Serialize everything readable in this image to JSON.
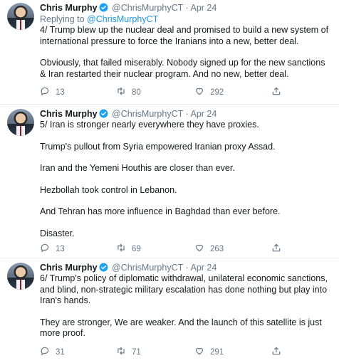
{
  "tweets": [
    {
      "author": "Chris Murphy",
      "handle": "@ChrisMurphyCT",
      "date": "Apr 24",
      "replying_prefix": "Replying to",
      "replying_to": "@ChrisMurphyCT",
      "paragraphs": [
        "4/ Trump blew up the nuclear deal and promised to build a new system of international pressure to force the Iranians into a new, better deal.",
        "Obviously, that failed miserably. Nobody signed up for the new sanctions & Iran restarted their nuclear program. And no new, better deal."
      ],
      "replies": "13",
      "retweets": "80",
      "likes": "292"
    },
    {
      "author": "Chris Murphy",
      "handle": "@ChrisMurphyCT",
      "date": "Apr 24",
      "paragraphs": [
        "5/ Iran is stronger nearly everywhere they have proxies.",
        "Trump's pullout from Syria empowered Iranian proxy Assad.",
        "Iran and the Yemeni Houthis are closer than ever.",
        "Hezbollah took control in Lebanon.",
        "And Tehran has more influence in Baghdad than ever before.",
        "Disaster."
      ],
      "replies": "13",
      "retweets": "69",
      "likes": "263"
    },
    {
      "author": "Chris Murphy",
      "handle": "@ChrisMurphyCT",
      "date": "Apr 24",
      "paragraphs": [
        "6/ Trump's policy of diplomatic withdrawal, unilateral economic sanctions, and blind, non-strategic military escalation has done nothing but play into Iran's hands.",
        "They are stronger, We are weaker. And the launch of this satellite is just more proof."
      ],
      "replies": "31",
      "retweets": "71",
      "likes": "291"
    }
  ],
  "separator": "·",
  "icons": {
    "avatar": "profile-photo",
    "verified": "verified-badge-icon",
    "reply": "reply-icon",
    "retweet": "retweet-icon",
    "like": "heart-icon",
    "share": "share-icon"
  },
  "colors": {
    "link": "#1b95e0",
    "muted": "#657786",
    "text": "#14171a",
    "verified": "#1da1f2"
  }
}
